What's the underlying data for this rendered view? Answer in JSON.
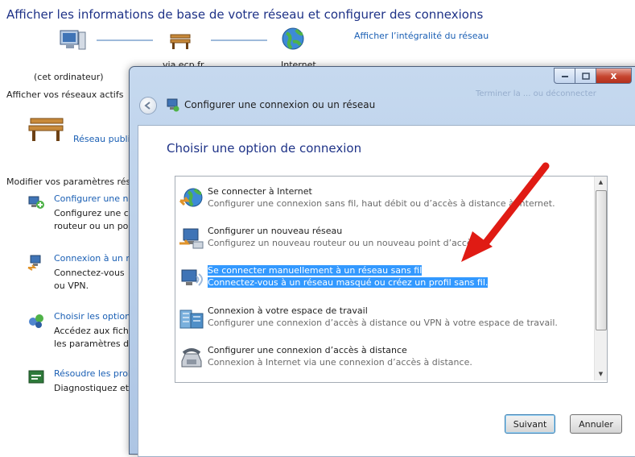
{
  "background": {
    "title": "Afficher les informations de base de votre réseau et configurer des connexions",
    "network_map": {
      "nodes": [
        {
          "label": "(cet ordinateur)",
          "icon": "computer-icon"
        },
        {
          "label": "via.ecp.fr",
          "icon": "bench-icon"
        },
        {
          "label": "Internet",
          "icon": "globe-icon"
        }
      ],
      "full_map_link": "Afficher l’intégralité du réseau"
    },
    "active_networks_label": "Afficher vos réseaux actifs",
    "public_network": "Réseau publi",
    "modify_settings_label": "Modifier vos paramètres rés",
    "tasks": [
      {
        "title": "Configurer une n",
        "desc": [
          "Configurez une c",
          "routeur ou un poi"
        ],
        "icon": "network-setup-icon"
      },
      {
        "title": "Connexion à un r",
        "desc": [
          "Connectez-vous",
          "ou VPN."
        ],
        "icon": "network-connect-icon"
      },
      {
        "title": "Choisir les option",
        "desc": [
          "Accédez aux fichi",
          "les paramètres de"
        ],
        "icon": "homegroup-icon"
      },
      {
        "title": "Résoudre les prob",
        "desc": [
          "Diagnostiquez et"
        ],
        "icon": "troubleshoot-icon"
      }
    ]
  },
  "dialog": {
    "window_title": "Configurer une connexion ou un réseau",
    "ghost_text": "Terminer la ... ou déconnecter",
    "heading": "Choisir une option de connexion",
    "options": [
      {
        "title": "Se connecter à Internet",
        "desc": "Configurer une connexion sans fil, haut débit ou d’accès à distance à Internet.",
        "icon": "internet-connect-icon",
        "selected": false
      },
      {
        "title": "Configurer un nouveau réseau",
        "desc": "Configurez un nouveau routeur ou un nouveau point d’accès.",
        "icon": "new-network-icon",
        "selected": false
      },
      {
        "title": "Se connecter manuellement à un réseau sans fil",
        "desc": "Connectez-vous à un réseau masqué ou créez un profil sans fil.",
        "icon": "wireless-manual-icon",
        "selected": true
      },
      {
        "title": "Connexion à votre espace de travail",
        "desc": "Configurer une connexion d’accès à distance ou VPN à votre espace de travail.",
        "icon": "workplace-icon",
        "selected": false
      },
      {
        "title": "Configurer une connexion d’accès à distance",
        "desc": "Connexion à Internet via une connexion d’accès à distance.",
        "icon": "dialup-phone-icon",
        "selected": false
      }
    ],
    "buttons": {
      "next": "Suivant",
      "cancel": "Annuler"
    },
    "titlebar_buttons": {
      "close": "x"
    }
  },
  "colors": {
    "accent": "#1e3287",
    "link": "#1a5fb4",
    "selection": "#3399ff",
    "annotation_arrow": "#e01b14"
  }
}
